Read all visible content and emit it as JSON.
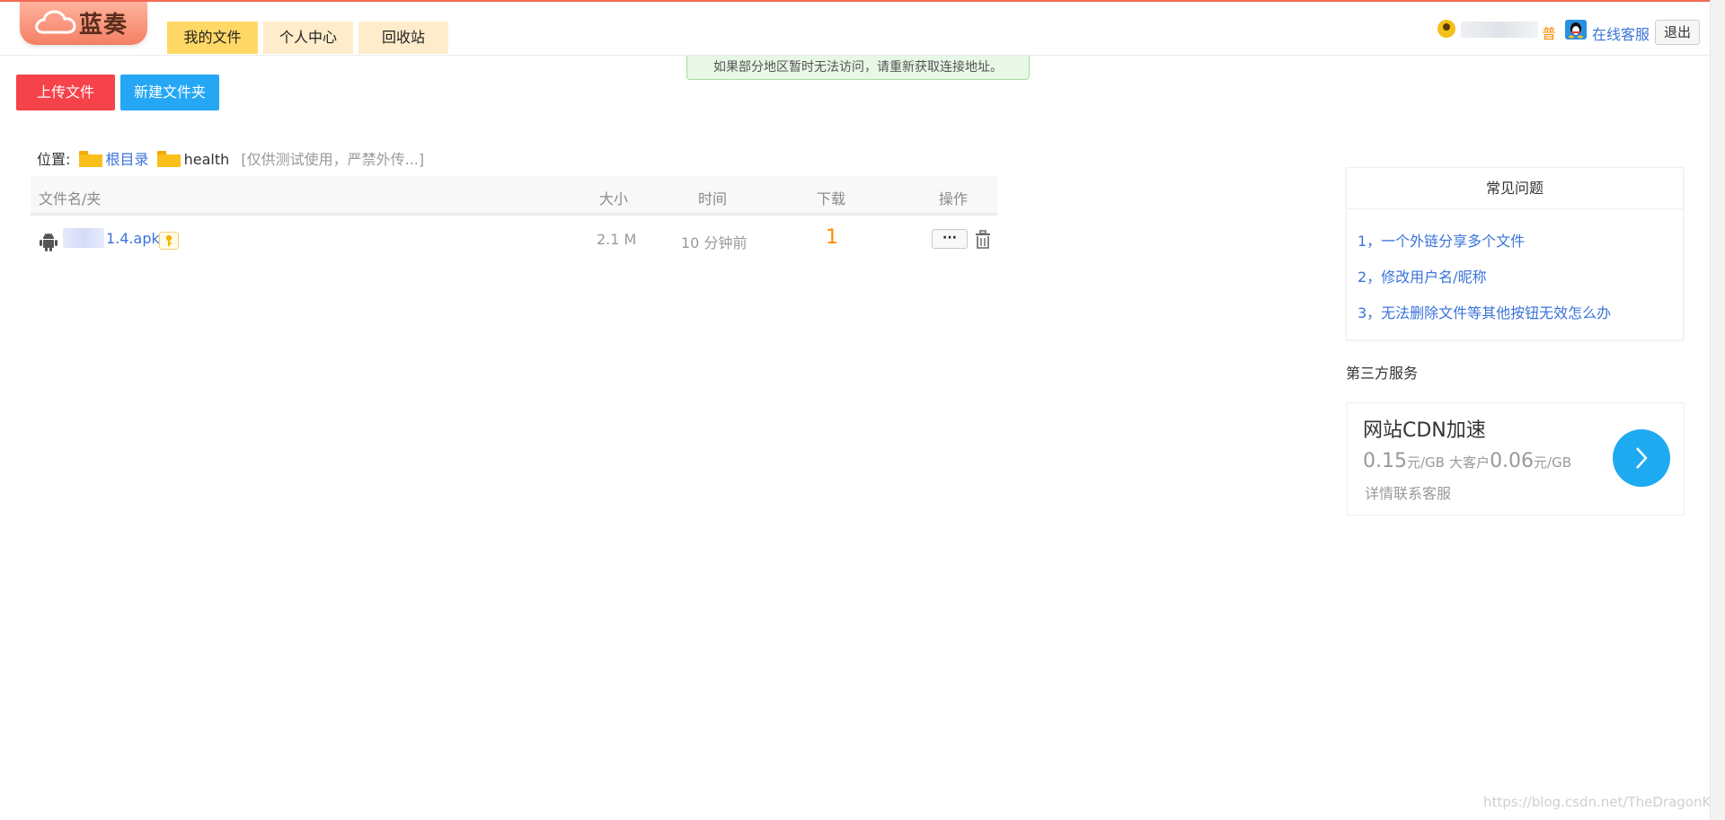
{
  "header": {
    "logo_text": "蓝奏",
    "nav": [
      {
        "label": "我的文件",
        "active": true
      },
      {
        "label": "个人中心",
        "active": false
      },
      {
        "label": "回收站",
        "active": false
      }
    ],
    "user_level": "普",
    "service_link": "在线客服",
    "logout_label": "退出"
  },
  "notice": "如果部分地区暂时无法访问，请重新获取连接地址。",
  "actions": {
    "upload_label": "上传文件",
    "new_folder_label": "新建文件夹"
  },
  "breadcrumb": {
    "prefix": "位置:",
    "root": "根目录",
    "current": "health",
    "note": "[仅供测试使用，严禁外传...]"
  },
  "table": {
    "headers": [
      "文件名/夹",
      "大小",
      "时间",
      "下载",
      "操作"
    ],
    "rows": [
      {
        "name": "1.4.apk",
        "size": "2.1 M",
        "time": "10 分钟前",
        "downloads": "1",
        "more": "···"
      }
    ]
  },
  "faq": {
    "title": "常见问题",
    "items": [
      "1，一个外链分享多个文件",
      "2，修改用户名/昵称",
      "3，无法删除文件等其他按钮无效怎么办"
    ]
  },
  "third_party": {
    "title": "第三方服务",
    "cdn": {
      "title": "网站CDN加速",
      "price1": "0.15",
      "unit1": "元/GB",
      "big_customer": "大客户",
      "price2": "0.06",
      "unit2": "元/GB",
      "contact": "详情联系客服"
    }
  },
  "watermark": "https://blog.csdn.net/TheDragonKing",
  "colors": {
    "accent_red": "#f6424a",
    "accent_blue": "#25a7f5",
    "link_blue": "#3a73d9",
    "orange": "#ff8a00",
    "nav_active": "#ffd866",
    "nav_inactive": "#ffeccb"
  },
  "icons": [
    "cloud-logo-icon",
    "user-icon",
    "qq-icon",
    "folder-icon",
    "android-icon",
    "key-icon",
    "trash-icon",
    "chevron-right-icon"
  ]
}
